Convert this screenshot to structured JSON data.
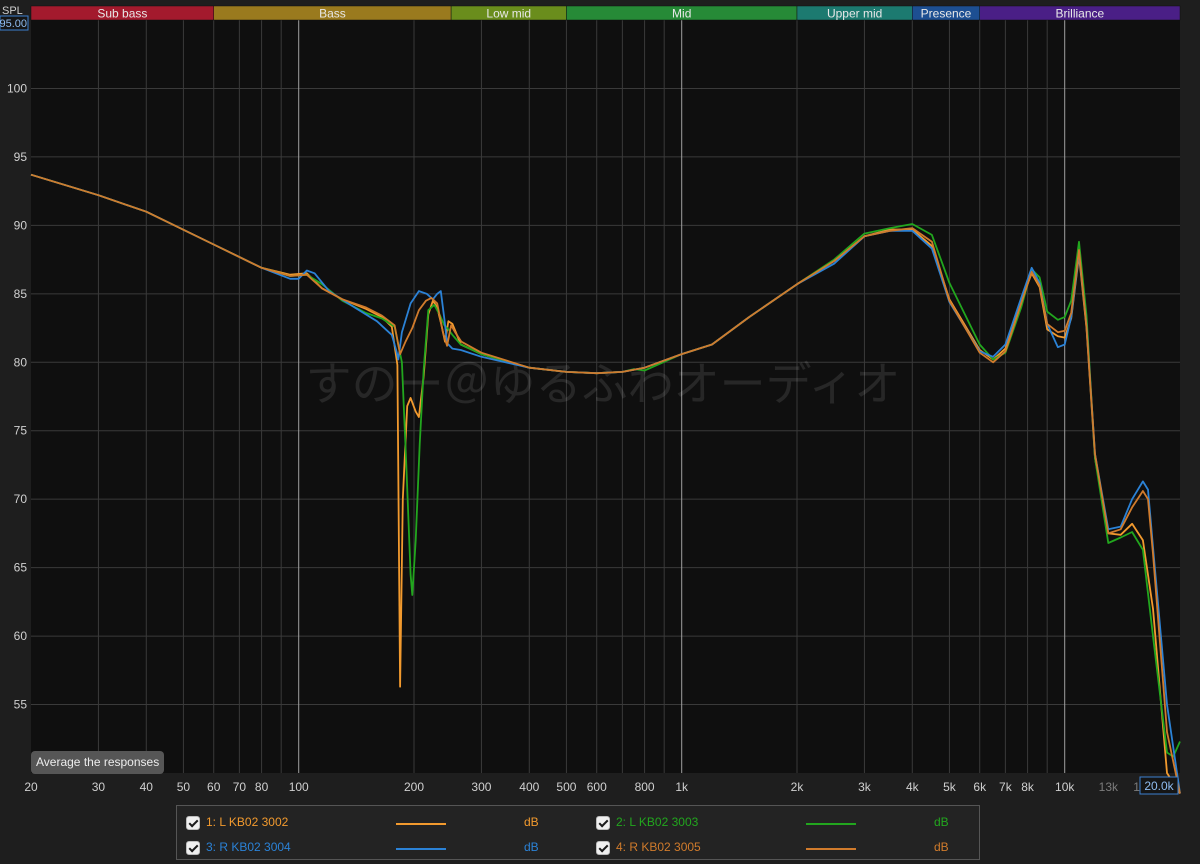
{
  "header": {
    "spl_label": "SPL",
    "top_value": "95.00"
  },
  "bands": [
    {
      "label": "Sub bass",
      "from": 20,
      "to": 60,
      "color": "#a31a2d"
    },
    {
      "label": "Bass",
      "from": 60,
      "to": 250,
      "color": "#9a7a1e"
    },
    {
      "label": "Low mid",
      "from": 250,
      "to": 500,
      "color": "#6a8d1c"
    },
    {
      "label": "Mid",
      "from": 500,
      "to": 2000,
      "color": "#268a37"
    },
    {
      "label": "Upper mid",
      "from": 2000,
      "to": 4000,
      "color": "#1c7a70"
    },
    {
      "label": "Presence",
      "from": 4000,
      "to": 6000,
      "color": "#1d4f92"
    },
    {
      "label": "Brilliance",
      "from": 6000,
      "to": 20000,
      "color": "#4a1f86"
    }
  ],
  "watermark": "すのー＠ゆるふわオーディオ",
  "controls": {
    "average_button": "Average the responses"
  },
  "chart_data": {
    "type": "line",
    "x_scale": "log",
    "xlim": [
      20,
      20000
    ],
    "ylim": [
      50,
      105
    ],
    "ylabel": "SPL",
    "grid": true,
    "x_ticks": [
      {
        "v": 20,
        "label": "20"
      },
      {
        "v": 30,
        "label": "30"
      },
      {
        "v": 40,
        "label": "40"
      },
      {
        "v": 50,
        "label": "50"
      },
      {
        "v": 60,
        "label": "60"
      },
      {
        "v": 70,
        "label": "70"
      },
      {
        "v": 80,
        "label": "80"
      },
      {
        "v": 100,
        "label": "100"
      },
      {
        "v": 200,
        "label": "200"
      },
      {
        "v": 300,
        "label": "300"
      },
      {
        "v": 400,
        "label": "400"
      },
      {
        "v": 500,
        "label": "500"
      },
      {
        "v": 600,
        "label": "600"
      },
      {
        "v": 800,
        "label": "800"
      },
      {
        "v": 1000,
        "label": "1k"
      },
      {
        "v": 2000,
        "label": "2k"
      },
      {
        "v": 3000,
        "label": "3k"
      },
      {
        "v": 4000,
        "label": "4k"
      },
      {
        "v": 5000,
        "label": "5k"
      },
      {
        "v": 6000,
        "label": "6k"
      },
      {
        "v": 7000,
        "label": "7k"
      },
      {
        "v": 8000,
        "label": "8k"
      },
      {
        "v": 10000,
        "label": "10k"
      },
      {
        "v": 13000,
        "label": "13k",
        "dim": true
      },
      {
        "v": 16000,
        "label": "16k",
        "dim": true
      },
      {
        "v": 20000,
        "label": "20.0k",
        "boxed": true
      }
    ],
    "y_ticks": [
      55,
      60,
      65,
      70,
      75,
      80,
      85,
      90,
      95,
      100
    ],
    "series": [
      {
        "name": "1: L KB02 3002",
        "unit": "dB",
        "color": "#f29a2e",
        "points": [
          [
            20,
            93.7
          ],
          [
            30,
            92.2
          ],
          [
            40,
            91.0
          ],
          [
            60,
            88.6
          ],
          [
            80,
            86.9
          ],
          [
            95,
            86.4
          ],
          [
            105,
            86.5
          ],
          [
            115,
            85.4
          ],
          [
            130,
            84.6
          ],
          [
            150,
            83.9
          ],
          [
            165,
            83.3
          ],
          [
            175,
            82.6
          ],
          [
            181,
            79.8
          ],
          [
            184,
            56.3
          ],
          [
            187,
            70.0
          ],
          [
            192,
            76.8
          ],
          [
            196,
            77.4
          ],
          [
            202,
            76.4
          ],
          [
            206,
            76.0
          ],
          [
            212,
            79.0
          ],
          [
            218,
            83.5
          ],
          [
            224,
            84.5
          ],
          [
            230,
            84.0
          ],
          [
            236,
            82.7
          ],
          [
            241,
            81.5
          ],
          [
            246,
            83.0
          ],
          [
            252,
            82.8
          ],
          [
            265,
            81.3
          ],
          [
            300,
            80.6
          ],
          [
            400,
            79.6
          ],
          [
            500,
            79.3
          ],
          [
            600,
            79.2
          ],
          [
            700,
            79.3
          ],
          [
            800,
            79.6
          ],
          [
            1000,
            80.6
          ],
          [
            1200,
            81.3
          ],
          [
            1500,
            83.3
          ],
          [
            2000,
            85.7
          ],
          [
            2500,
            87.4
          ],
          [
            3000,
            89.2
          ],
          [
            3500,
            89.7
          ],
          [
            4000,
            89.7
          ],
          [
            4500,
            88.5
          ],
          [
            5000,
            84.6
          ],
          [
            6000,
            80.9
          ],
          [
            6500,
            80.2
          ],
          [
            7000,
            81.0
          ],
          [
            7700,
            84.5
          ],
          [
            8200,
            86.5
          ],
          [
            8600,
            85.5
          ],
          [
            9000,
            82.4
          ],
          [
            9600,
            81.9
          ],
          [
            10000,
            81.8
          ],
          [
            10400,
            83.2
          ],
          [
            10900,
            87.8
          ],
          [
            11400,
            82.5
          ],
          [
            12000,
            73.0
          ],
          [
            13000,
            67.5
          ],
          [
            14000,
            67.4
          ],
          [
            15000,
            68.2
          ],
          [
            16000,
            67.0
          ],
          [
            17000,
            62.0
          ],
          [
            18500,
            50.0
          ],
          [
            20000,
            48.5
          ]
        ]
      },
      {
        "name": "2: L KB02 3003",
        "unit": "dB",
        "color": "#22a61e",
        "points": [
          [
            20,
            93.7
          ],
          [
            30,
            92.2
          ],
          [
            40,
            91.0
          ],
          [
            60,
            88.6
          ],
          [
            80,
            86.9
          ],
          [
            95,
            86.3
          ],
          [
            105,
            86.4
          ],
          [
            115,
            85.7
          ],
          [
            130,
            84.5
          ],
          [
            150,
            83.6
          ],
          [
            165,
            83.2
          ],
          [
            178,
            82.6
          ],
          [
            186,
            80.0
          ],
          [
            191,
            72.5
          ],
          [
            196,
            64.5
          ],
          [
            198,
            63.0
          ],
          [
            202,
            67.0
          ],
          [
            207,
            74.0
          ],
          [
            212,
            79.5
          ],
          [
            218,
            83.8
          ],
          [
            226,
            84.2
          ],
          [
            234,
            83.4
          ],
          [
            240,
            82.7
          ],
          [
            246,
            82.4
          ],
          [
            252,
            82.0
          ],
          [
            265,
            81.3
          ],
          [
            300,
            80.6
          ],
          [
            400,
            79.6
          ],
          [
            500,
            79.3
          ],
          [
            600,
            79.2
          ],
          [
            700,
            79.3
          ],
          [
            750,
            79.5
          ],
          [
            800,
            79.4
          ],
          [
            1000,
            80.6
          ],
          [
            1200,
            81.3
          ],
          [
            1500,
            83.3
          ],
          [
            2000,
            85.7
          ],
          [
            2500,
            87.5
          ],
          [
            3000,
            89.4
          ],
          [
            3500,
            89.8
          ],
          [
            4000,
            90.1
          ],
          [
            4500,
            89.3
          ],
          [
            5000,
            85.8
          ],
          [
            6000,
            81.3
          ],
          [
            6500,
            80.2
          ],
          [
            7000,
            80.7
          ],
          [
            7700,
            84.0
          ],
          [
            8200,
            86.8
          ],
          [
            8600,
            86.2
          ],
          [
            9000,
            83.7
          ],
          [
            9600,
            83.1
          ],
          [
            10000,
            83.3
          ],
          [
            10400,
            84.5
          ],
          [
            10900,
            88.8
          ],
          [
            11400,
            83.4
          ],
          [
            12000,
            73.0
          ],
          [
            13000,
            66.8
          ],
          [
            14000,
            67.2
          ],
          [
            15000,
            67.6
          ],
          [
            16000,
            66.3
          ],
          [
            17000,
            60.0
          ],
          [
            18500,
            51.5
          ],
          [
            19200,
            51.2
          ],
          [
            20000,
            52.3
          ]
        ]
      },
      {
        "name": "3: R KB02 3004",
        "unit": "dB",
        "color": "#2b82d6",
        "points": [
          [
            20,
            93.7
          ],
          [
            30,
            92.2
          ],
          [
            40,
            91.0
          ],
          [
            60,
            88.6
          ],
          [
            80,
            86.9
          ],
          [
            95,
            86.1
          ],
          [
            100,
            86.1
          ],
          [
            105,
            86.7
          ],
          [
            110,
            86.5
          ],
          [
            120,
            85.2
          ],
          [
            140,
            84.0
          ],
          [
            160,
            83.0
          ],
          [
            175,
            82.0
          ],
          [
            180,
            80.8
          ],
          [
            182,
            80.2
          ],
          [
            186,
            82.2
          ],
          [
            196,
            84.3
          ],
          [
            206,
            85.2
          ],
          [
            216,
            85.0
          ],
          [
            224,
            84.6
          ],
          [
            230,
            85.0
          ],
          [
            235,
            85.2
          ],
          [
            240,
            83.2
          ],
          [
            244,
            81.4
          ],
          [
            252,
            81.0
          ],
          [
            265,
            80.9
          ],
          [
            300,
            80.4
          ],
          [
            400,
            79.6
          ],
          [
            500,
            79.3
          ],
          [
            600,
            79.2
          ],
          [
            700,
            79.3
          ],
          [
            800,
            79.6
          ],
          [
            1000,
            80.6
          ],
          [
            1200,
            81.3
          ],
          [
            1500,
            83.3
          ],
          [
            2000,
            85.7
          ],
          [
            2500,
            87.2
          ],
          [
            3000,
            89.2
          ],
          [
            3500,
            89.6
          ],
          [
            4000,
            89.6
          ],
          [
            4500,
            88.3
          ],
          [
            5000,
            84.4
          ],
          [
            6000,
            80.8
          ],
          [
            6500,
            80.4
          ],
          [
            7000,
            81.3
          ],
          [
            7700,
            84.7
          ],
          [
            8200,
            86.9
          ],
          [
            8600,
            85.8
          ],
          [
            9000,
            82.8
          ],
          [
            9600,
            81.1
          ],
          [
            10000,
            81.3
          ],
          [
            10400,
            83.3
          ],
          [
            10900,
            88.0
          ],
          [
            11400,
            82.7
          ],
          [
            12000,
            73.3
          ],
          [
            13000,
            67.8
          ],
          [
            14000,
            68.0
          ],
          [
            15000,
            70.0
          ],
          [
            16000,
            71.3
          ],
          [
            16500,
            70.7
          ],
          [
            17000,
            66.5
          ],
          [
            18500,
            55.0
          ],
          [
            20000,
            48.5
          ]
        ]
      },
      {
        "name": "4: R KB02 3005",
        "unit": "dB",
        "color": "#d07b2c",
        "points": [
          [
            20,
            93.7
          ],
          [
            30,
            92.2
          ],
          [
            40,
            91.0
          ],
          [
            60,
            88.6
          ],
          [
            80,
            86.9
          ],
          [
            95,
            86.3
          ],
          [
            105,
            86.4
          ],
          [
            115,
            85.4
          ],
          [
            130,
            84.6
          ],
          [
            150,
            84.0
          ],
          [
            165,
            83.4
          ],
          [
            178,
            82.7
          ],
          [
            184,
            80.6
          ],
          [
            190,
            81.5
          ],
          [
            198,
            82.5
          ],
          [
            206,
            83.8
          ],
          [
            215,
            84.5
          ],
          [
            222,
            84.7
          ],
          [
            230,
            84.3
          ],
          [
            238,
            82.2
          ],
          [
            244,
            81.2
          ],
          [
            250,
            82.7
          ],
          [
            256,
            82.2
          ],
          [
            266,
            81.5
          ],
          [
            300,
            80.7
          ],
          [
            400,
            79.6
          ],
          [
            500,
            79.3
          ],
          [
            600,
            79.2
          ],
          [
            700,
            79.3
          ],
          [
            800,
            79.6
          ],
          [
            1000,
            80.6
          ],
          [
            1200,
            81.3
          ],
          [
            1500,
            83.3
          ],
          [
            2000,
            85.7
          ],
          [
            2500,
            87.4
          ],
          [
            3000,
            89.2
          ],
          [
            3500,
            89.6
          ],
          [
            4000,
            89.8
          ],
          [
            4500,
            88.8
          ],
          [
            5000,
            84.5
          ],
          [
            6000,
            80.7
          ],
          [
            6500,
            80.0
          ],
          [
            7000,
            80.8
          ],
          [
            7700,
            84.3
          ],
          [
            8200,
            86.6
          ],
          [
            8600,
            85.6
          ],
          [
            9000,
            82.8
          ],
          [
            9600,
            82.2
          ],
          [
            10000,
            82.3
          ],
          [
            10400,
            83.6
          ],
          [
            10900,
            88.2
          ],
          [
            11400,
            82.6
          ],
          [
            12000,
            73.3
          ],
          [
            13000,
            67.5
          ],
          [
            14000,
            67.8
          ],
          [
            15000,
            69.4
          ],
          [
            16000,
            70.6
          ],
          [
            16500,
            70.0
          ],
          [
            17000,
            66.0
          ],
          [
            18500,
            53.0
          ],
          [
            20000,
            48.5
          ]
        ]
      }
    ]
  }
}
